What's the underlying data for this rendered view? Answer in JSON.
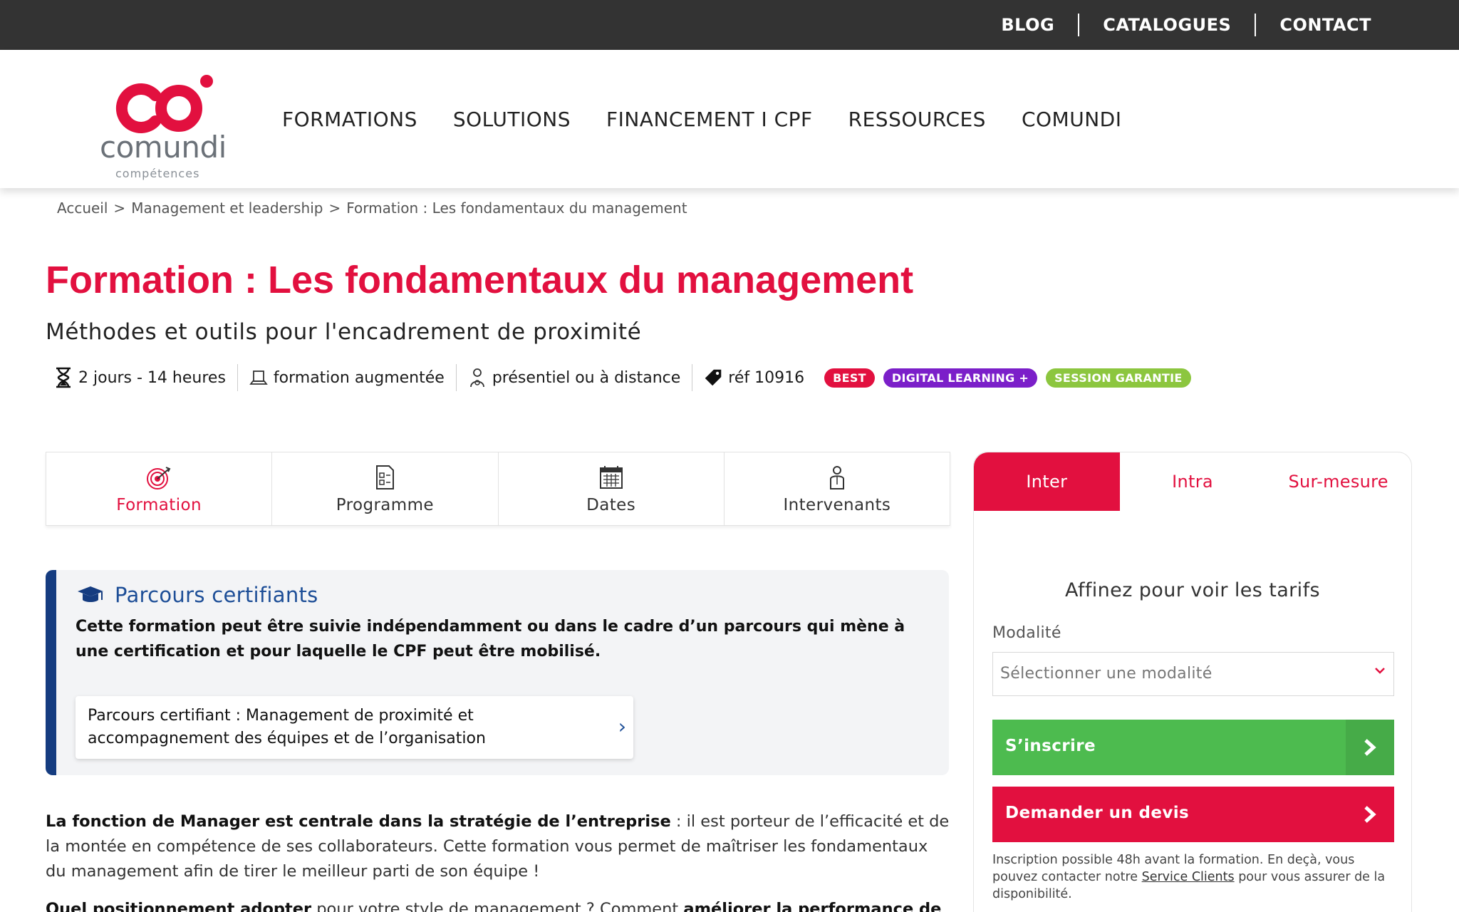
{
  "topbar": {
    "links": [
      "BLOG",
      "CATALOGUES",
      "CONTACT"
    ]
  },
  "header": {
    "logo_word": "comundi",
    "logo_sub": "compétences",
    "nav": [
      "FORMATIONS",
      "SOLUTIONS",
      "FINANCEMENT I CPF",
      "RESSOURCES",
      "COMUNDI"
    ]
  },
  "breadcrumb": {
    "items": [
      "Accueil",
      "Management et leadership",
      "Formation : Les fondamentaux du management"
    ],
    "separator": ">"
  },
  "page": {
    "title": "Formation : Les fondamentaux du management",
    "subtitle": "Méthodes et outils pour l'encadrement de proximité"
  },
  "meta": {
    "duration": "2 jours - 14 heures",
    "format": "formation augmentée",
    "mode": "présentiel ou à distance",
    "ref": "réf 10916",
    "badges": [
      {
        "label": "BEST",
        "color": "#e2103f"
      },
      {
        "label": "DIGITAL LEARNING +",
        "color": "#7b1fc9"
      },
      {
        "label": "SESSION GARANTIE",
        "color": "#8cc63f"
      }
    ]
  },
  "tabs": [
    {
      "label": "Formation",
      "icon": "target-icon",
      "active": true
    },
    {
      "label": "Programme",
      "icon": "document-icon",
      "active": false
    },
    {
      "label": "Dates",
      "icon": "calendar-icon",
      "active": false
    },
    {
      "label": "Intervenants",
      "icon": "person-icon",
      "active": false
    }
  ],
  "parcours": {
    "title": "Parcours certifiants",
    "text": "Cette formation peut être suivie indépendamment ou dans le cadre d’un parcours qui mène à une certification et pour laquelle le CPF peut être mobilisé.",
    "card_text": "Parcours certifiant : Management de proximité et accompagnement des équipes et de l’organisation"
  },
  "description": {
    "p1_bold": "La fonction de Manager est centrale dans la stratégie de l’entreprise",
    "p1_rest": " : il est porteur de l’efficacité et de la montée en compétence de ses collaborateurs. Cette formation vous permet de maîtriser les fondamentaux du management afin de tirer le meilleur parti de son équipe !",
    "p2_bold": "Quel positionnement adopter",
    "p2_rest": " pour votre style de management ? Comment ",
    "p2_bold2": "améliorer la performance de"
  },
  "panel": {
    "tabs": [
      "Inter",
      "Intra",
      "Sur-mesure"
    ],
    "heading": "Affinez pour voir les tarifs",
    "modalite_label": "Modalité",
    "select_placeholder": "Sélectionner une modalité",
    "btn_inscrire": "S’inscrire",
    "btn_devis": "Demander un devis",
    "note_before": "Inscription possible 48h avant la formation. En deçà, vous pouvez contacter notre ",
    "note_link": "Service Clients",
    "note_after": " pour vous assurer de la disponibilité."
  },
  "colors": {
    "brand_red": "#e2103f",
    "dark_bar": "#333333",
    "navy": "#153c80",
    "green": "#4dbb4f"
  }
}
